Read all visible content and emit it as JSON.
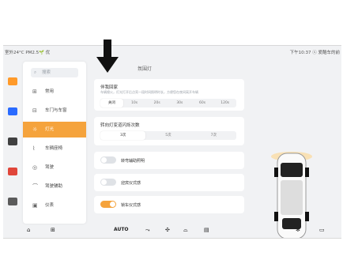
{
  "status": {
    "left": "室外24°C  PM2.5🌱 优",
    "right": "下午10:37  ⓢ 爱酷车的前"
  },
  "menu": {
    "search_placeholder": "搜索",
    "items": [
      {
        "icon": "car-icon",
        "label": "常用"
      },
      {
        "icon": "door-icon",
        "label": "车门与车窗"
      },
      {
        "icon": "light-icon",
        "label": "灯光"
      },
      {
        "icon": "seat-icon",
        "label": "车辆座椅"
      },
      {
        "icon": "drive-icon",
        "label": "驾驶"
      },
      {
        "icon": "assist-icon",
        "label": "驾驶辅助"
      },
      {
        "icon": "instrument-icon",
        "label": "仪表"
      }
    ]
  },
  "content": {
    "title": "氛围灯",
    "card1": {
      "title": "伴我回家",
      "subtitle": "车辆熄火，灯光打开后点亮一段时间照明时长，方便您在夜间离开车辆",
      "options": [
        "关闭",
        "10s",
        "20s",
        "30s",
        "60s",
        "120s"
      ],
      "selected": 0
    },
    "card2": {
      "title": "转向灯变道闪烁次数",
      "options": [
        "3次",
        "5次",
        "7次"
      ],
      "selected": 0
    },
    "card3": {
      "label": "转弯辅助照明",
      "on": false
    },
    "card4": {
      "label": "迎宾仪式感",
      "on": false
    },
    "card5": {
      "label": "锁车仪式感",
      "on": true
    }
  },
  "dock": {
    "auto": "AUTO"
  }
}
